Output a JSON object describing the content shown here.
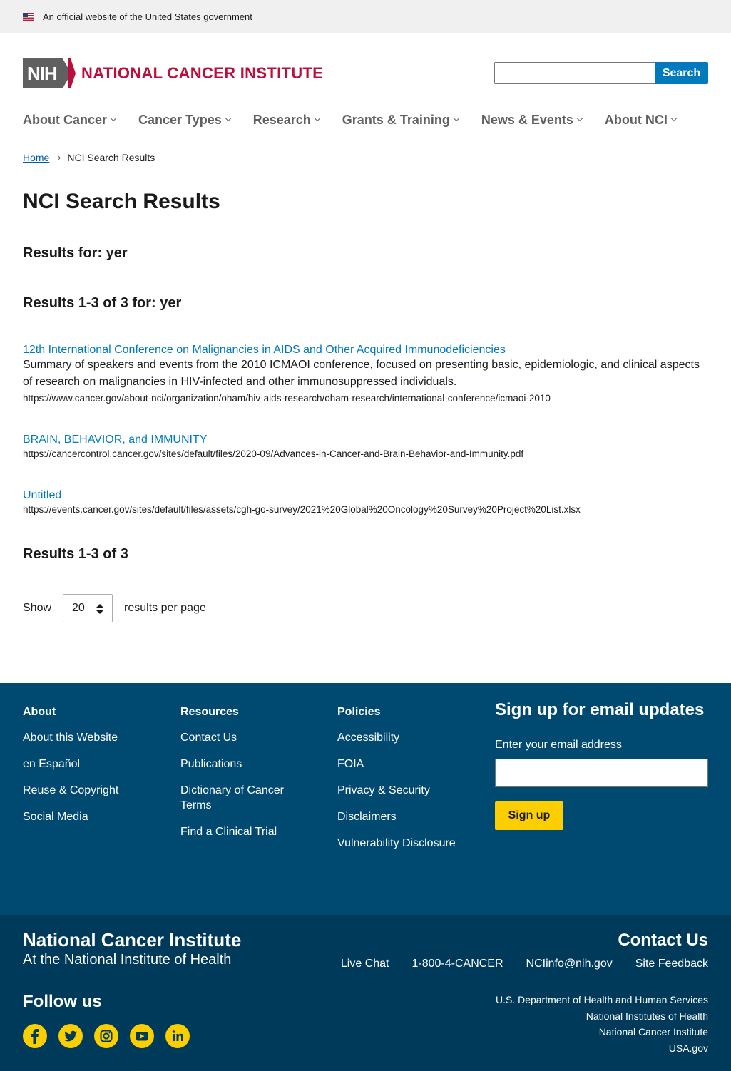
{
  "banner": {
    "text": "An official website of the United States government"
  },
  "header": {
    "logo_abbr": "NIH",
    "logo_text": "NATIONAL CANCER INSTITUTE",
    "search_button": "Search"
  },
  "nav": {
    "items": [
      {
        "label": "About Cancer"
      },
      {
        "label": "Cancer Types"
      },
      {
        "label": "Research"
      },
      {
        "label": "Grants & Training"
      },
      {
        "label": "News & Events"
      },
      {
        "label": "About NCI"
      }
    ]
  },
  "breadcrumb": {
    "home": "Home",
    "current": "NCI Search Results"
  },
  "page": {
    "title": "NCI Search Results",
    "results_for": "Results for: yer",
    "results_range": "Results 1-3 of 3 for: yer",
    "results_footer": "Results 1-3 of 3"
  },
  "results": [
    {
      "title": "12th International Conference on Malignancies in AIDS and Other Acquired Immunodeficiencies",
      "description": "Summary of speakers and events from the 2010 ICMAOI conference, focused on presenting basic, epidemiologic, and clinical aspects of research on malignancies in HIV-infected and other immunosuppressed individuals.",
      "url": "https://www.cancer.gov/about-nci/organization/oham/hiv-aids-research/oham-research/international-conference/icmaoi-2010"
    },
    {
      "title": "BRAIN, BEHAVIOR, and IMMUNITY",
      "description": "",
      "url": "https://cancercontrol.cancer.gov/sites/default/files/2020-09/Advances-in-Cancer-and-Brain-Behavior-and-Immunity.pdf"
    },
    {
      "title": "Untitled",
      "description": "",
      "url": "https://events.cancer.gov/sites/default/files/assets/cgh-go-survey/2021%20Global%20Oncology%20Survey%20Project%20List.xlsx"
    }
  ],
  "pagination": {
    "show_label": "Show",
    "per_page_value": "20",
    "suffix": "results per page"
  },
  "footer": {
    "columns": [
      {
        "heading": "About",
        "links": [
          "About this Website",
          "en Español",
          "Reuse & Copyright",
          "Social Media"
        ]
      },
      {
        "heading": "Resources",
        "links": [
          "Contact Us",
          "Publications",
          "Dictionary of Cancer Terms",
          "Find a Clinical Trial"
        ]
      },
      {
        "heading": "Policies",
        "links": [
          "Accessibility",
          "FOIA",
          "Privacy & Security",
          "Disclaimers",
          "Vulnerability Disclosure"
        ]
      }
    ],
    "signup": {
      "title": "Sign up for email updates",
      "label": "Enter your email address",
      "button": "Sign up"
    },
    "org_name": "National Cancer Institute",
    "org_sub": "At the National Institute of Health",
    "follow": "Follow us",
    "social_icons": [
      "facebook-icon",
      "twitter-icon",
      "instagram-icon",
      "youtube-icon",
      "linkedin-icon"
    ],
    "contact_heading": "Contact Us",
    "contact_links": [
      "Live Chat",
      "1-800-4-CANCER",
      "NCIinfo@nih.gov",
      "Site Feedback"
    ],
    "gov_links": [
      "U.S. Department of Health and Human Services",
      "National Institutes of Health",
      "National Cancer Institute",
      "USA.gov"
    ]
  },
  "colors": {
    "brand_red": "#bb0e3d",
    "link_blue": "#007abd",
    "footer_blue": "#004971",
    "footer_dark": "#003a5b",
    "accent_yellow": "#face00"
  }
}
